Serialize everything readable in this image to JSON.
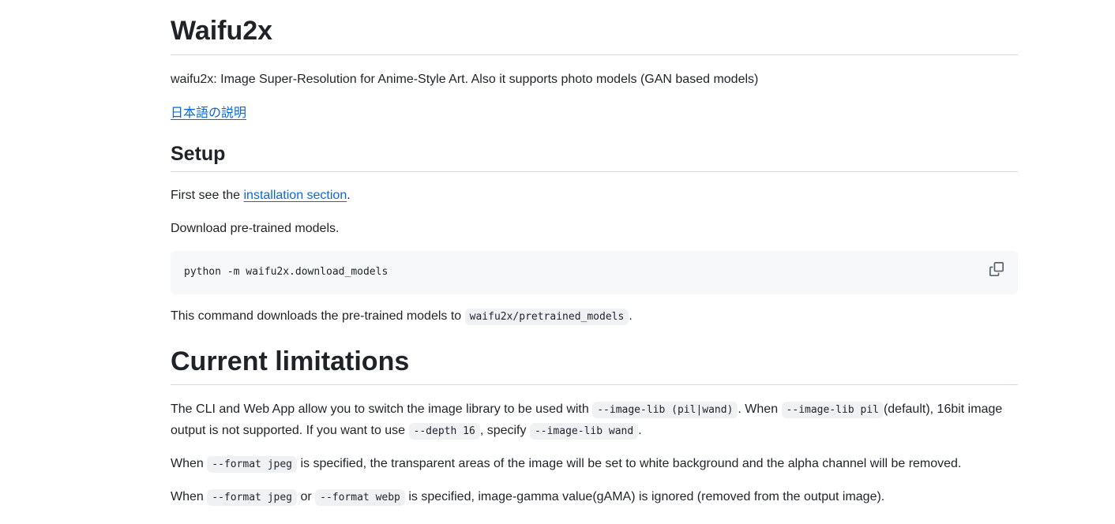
{
  "title": "Waifu2x",
  "intro": "waifu2x: Image Super-Resolution for Anime-Style Art. Also it supports photo models (GAN based models)",
  "jp_link": "日本語の説明",
  "setup": {
    "heading": "Setup",
    "first_see_prefix": "First see the ",
    "installation_link": "installation section",
    "first_see_suffix": ".",
    "download_text": "Download pre-trained models.",
    "command": "python -m waifu2x.download_models",
    "copy_icon": "copy-icon",
    "cmd_text_prefix": "This command downloads the pre-trained models to ",
    "cmd_code": "waifu2x/pretrained_models",
    "cmd_text_suffix": "."
  },
  "limitations": {
    "heading": "Current limitations",
    "p1": {
      "t1": "The CLI and Web App allow you to switch the image library to be used with ",
      "c1": "--image-lib (pil|wand)",
      "t2": ". When ",
      "c2": "--image-lib pil",
      "t3": "(default), 16bit image output is not supported. If you want to use ",
      "c3": "--depth 16",
      "t4": ", specify ",
      "c4": "--image-lib wand",
      "t5": "."
    },
    "p2": {
      "t1": "When ",
      "c1": "--format jpeg",
      "t2": " is specified, the transparent areas of the image will be set to white background and the alpha channel will be removed."
    },
    "p3": {
      "t1": "When ",
      "c1": "--format jpeg",
      "t2": " or ",
      "c2": "--format webp",
      "t3": " is specified, image-gamma value(gAMA) is ignored (removed from the output image)."
    }
  }
}
